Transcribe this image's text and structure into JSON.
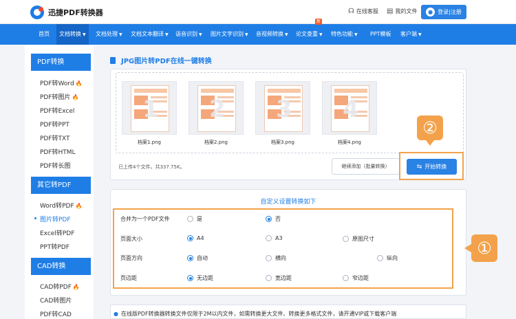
{
  "header": {
    "logo_text": "迅捷PDF转换器",
    "links": [
      {
        "icon": "headset-icon",
        "label": "在线客服"
      },
      {
        "icon": "document-icon",
        "label": "我的文件"
      }
    ],
    "login_label": "登录|注册"
  },
  "nav": {
    "items": [
      {
        "label": "首页",
        "caret": false
      },
      {
        "label": "文档转换",
        "caret": true,
        "active": true
      },
      {
        "label": "文档处理",
        "caret": true
      },
      {
        "label": "文档文本翻译",
        "caret": true
      },
      {
        "label": "语音识别",
        "caret": true
      },
      {
        "label": "图片文字识别",
        "caret": true
      },
      {
        "label": "音视频转换",
        "caret": true
      },
      {
        "label": "论文查重",
        "caret": true,
        "badge": "新"
      },
      {
        "label": "特色功能",
        "caret": true
      },
      {
        "label": "PPT模板",
        "caret": false
      },
      {
        "label": "客户端",
        "caret": true
      }
    ]
  },
  "sidebar": {
    "sections": [
      {
        "title": "PDF转换",
        "items": [
          {
            "label": "PDF转Word",
            "hot": true
          },
          {
            "label": "PDF转图片",
            "hot": true
          },
          {
            "label": "PDF转Excel"
          },
          {
            "label": "PDF转PPT"
          },
          {
            "label": "PDF转TXT"
          },
          {
            "label": "PDF转HTML"
          },
          {
            "label": "PDF转长图"
          }
        ]
      },
      {
        "title": "其它转PDF",
        "items": [
          {
            "label": "Word转PDF",
            "hot": true
          },
          {
            "label": "图片转PDF",
            "active": true
          },
          {
            "label": "Excel转PDF"
          },
          {
            "label": "PPT转PDF"
          }
        ]
      },
      {
        "title": "CAD转换",
        "items": [
          {
            "label": "CAD转PDF",
            "hot": true
          },
          {
            "label": "CAD转图片"
          },
          {
            "label": "PDF转CAD"
          }
        ]
      }
    ]
  },
  "main": {
    "title": "JPG图片转PDF在线一键转换",
    "files": [
      {
        "name": "档案1.png",
        "num": "1"
      },
      {
        "name": "档案2.png",
        "num": "2"
      },
      {
        "name": "档案3.png",
        "num": "3"
      },
      {
        "name": "档案4.png",
        "num": "4"
      }
    ],
    "upload_status": "已上传4个文件，共337.75K。",
    "add_button": "继续添加（批量转换）",
    "start_button": "开始转换",
    "callout_1": "①",
    "callout_2": "②"
  },
  "settings": {
    "title": "自定义设置转换如下",
    "rows": [
      {
        "label": "合并为一个PDF文件",
        "options": [
          "是",
          "否"
        ],
        "selected": 1
      },
      {
        "label": "页面大小",
        "options": [
          "A4",
          "A3",
          "原图尺寸"
        ],
        "selected": 0
      },
      {
        "label": "页面方向",
        "options": [
          "自动",
          "横向",
          "纵向"
        ],
        "selected": 0
      },
      {
        "label": "页边距",
        "options": [
          "无边距",
          "宽边距",
          "窄边距"
        ],
        "selected": 0
      }
    ]
  },
  "note": "在线版PDF转换器转换文件仅限于2M以内文件，如需转换更大文件、转换更多格式文件，请开通VIP或下载客户端"
}
